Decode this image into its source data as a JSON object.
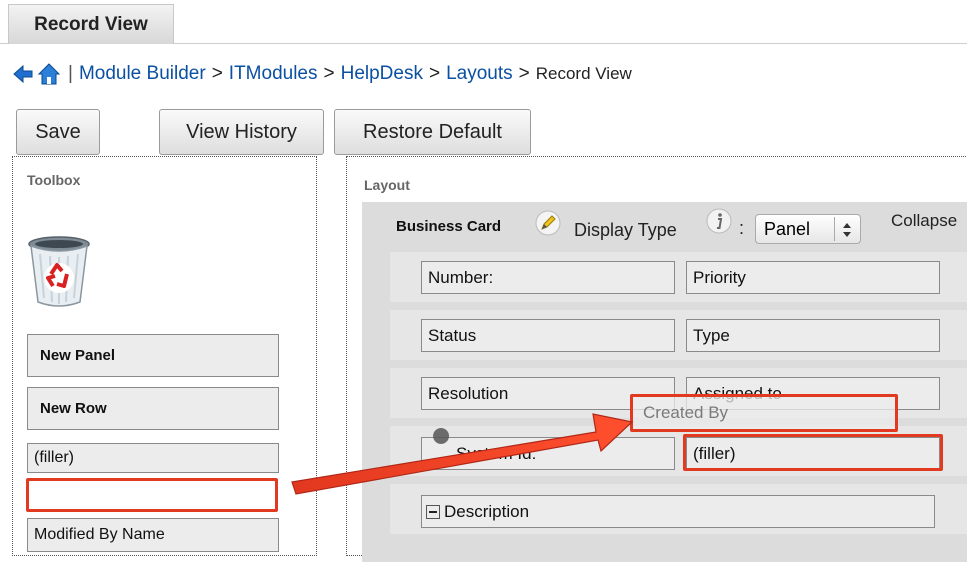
{
  "tab": {
    "label": "Record View"
  },
  "breadcrumb": {
    "items": [
      "Module Builder",
      "ITModules",
      "HelpDesk",
      "Layouts"
    ],
    "current": "Record View",
    "separator": ">",
    "pipe": "|"
  },
  "toolbar": {
    "save_label": "Save",
    "history_label": "View History",
    "restore_label": "Restore Default"
  },
  "toolbox": {
    "title": "Toolbox",
    "new_panel": "New Panel",
    "new_row": "New Row",
    "filler": "(filler)",
    "drag_slot": "",
    "modified_by": "Modified By Name"
  },
  "layout": {
    "title": "Layout",
    "panel_name": "Business Card",
    "display_type_label": "Display Type",
    "colon": ":",
    "display_type_value": "Panel",
    "collapse_label": "Collapse",
    "rows": [
      {
        "left": "Number:",
        "right": "Priority"
      },
      {
        "left": "Status",
        "right": "Type"
      },
      {
        "left": "Resolution",
        "right": "Assigned to"
      },
      {
        "left": "System Id:",
        "right": "(filler)"
      }
    ],
    "dragging_field": "Created By",
    "description": "Description"
  },
  "colors": {
    "link": "#0b50a2",
    "highlight": "#e23a21"
  }
}
